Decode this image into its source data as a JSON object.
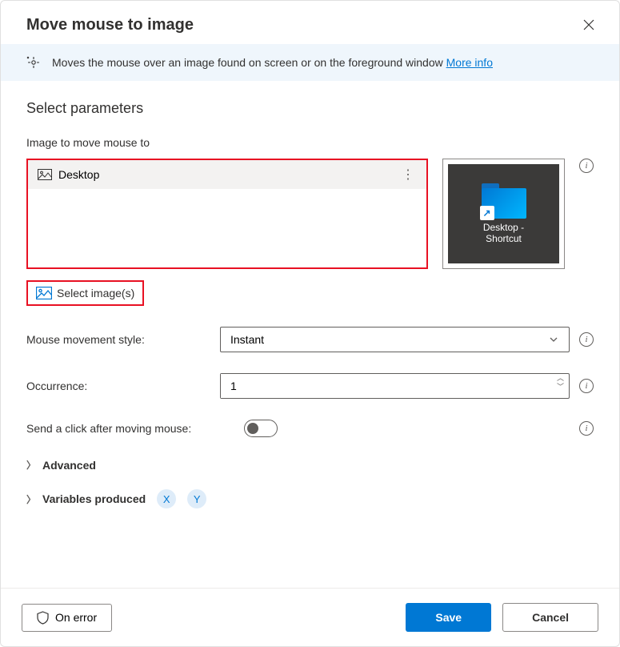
{
  "header": {
    "title": "Move mouse to image"
  },
  "banner": {
    "text": "Moves the mouse over an image found on screen or on the foreground window ",
    "link": "More info"
  },
  "section": {
    "title": "Select parameters",
    "image_label": "Image to move mouse to",
    "selected_image": "Desktop",
    "preview_caption_line1": "Desktop -",
    "preview_caption_line2": "Shortcut",
    "select_images_label": "Select image(s)"
  },
  "fields": {
    "movement_label": "Mouse movement style:",
    "movement_value": "Instant",
    "occurrence_label": "Occurrence:",
    "occurrence_value": "1",
    "send_click_label": "Send a click after moving mouse:"
  },
  "expanders": {
    "advanced": "Advanced",
    "variables": "Variables produced",
    "var_x": "X",
    "var_y": "Y"
  },
  "footer": {
    "on_error": "On error",
    "save": "Save",
    "cancel": "Cancel"
  }
}
